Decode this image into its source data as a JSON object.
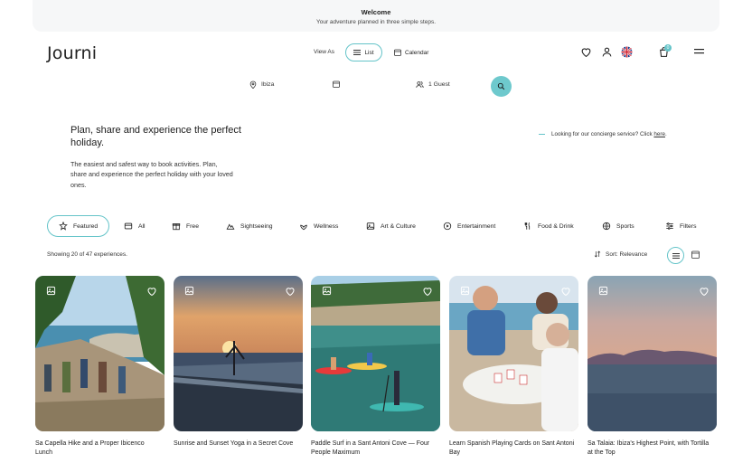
{
  "banner": {
    "title": "Welcome",
    "subtitle": "Your adventure planned in three simple steps."
  },
  "header": {
    "logo": "Journi",
    "view_as_label": "View As",
    "list_label": "List",
    "calendar_label": "Calendar",
    "cart_count": "0",
    "icons": [
      "heart-icon",
      "user-icon",
      "uk-flag-icon",
      "cart-icon",
      "menu-icon"
    ]
  },
  "search": {
    "location": "Ibiza",
    "date": "",
    "guests": "1 Guest"
  },
  "hero": {
    "title": "Plan, share and experience the perfect holiday.",
    "description": "The easiest and safest way to book activities. Plan, share and experience the perfect holiday with your loved ones."
  },
  "concierge": {
    "text": "Looking for our concierge service? Click ",
    "link": "here",
    "suffix": "."
  },
  "categories": [
    {
      "label": "Featured",
      "icon": "featured-icon",
      "active": true
    },
    {
      "label": "All",
      "icon": "all-icon",
      "active": false
    },
    {
      "label": "Free",
      "icon": "free-icon",
      "active": false
    },
    {
      "label": "Sightseeing",
      "icon": "sightseeing-icon",
      "active": false
    },
    {
      "label": "Wellness",
      "icon": "wellness-icon",
      "active": false
    },
    {
      "label": "Art & Culture",
      "icon": "art-culture-icon",
      "active": false
    },
    {
      "label": "Entertainment",
      "icon": "entertainment-icon",
      "active": false
    },
    {
      "label": "Food & Drink",
      "icon": "food-drink-icon",
      "active": false
    },
    {
      "label": "Sports",
      "icon": "sports-icon",
      "active": false
    }
  ],
  "filters_label": "Filters",
  "results": {
    "showing": "Showing 20 of 47 experiences.",
    "sort_label": "Sort: Relevance"
  },
  "colors": {
    "accent": "#65c4c9",
    "text": "#1f2328",
    "banner_bg": "#f6f7f8"
  },
  "cards": [
    {
      "title": "Sa Capella Hike and a Proper Ibicenco Lunch"
    },
    {
      "title": "Sunrise and Sunset Yoga in a Secret Cove"
    },
    {
      "title": "Paddle Surf in a Sant Antoni Cove — Four People Maximum"
    },
    {
      "title": "Learn Spanish Playing Cards on Sant Antoni Bay"
    },
    {
      "title": "Sa Talaia: Ibiza's Highest Point, with Tortilla at the Top"
    }
  ]
}
